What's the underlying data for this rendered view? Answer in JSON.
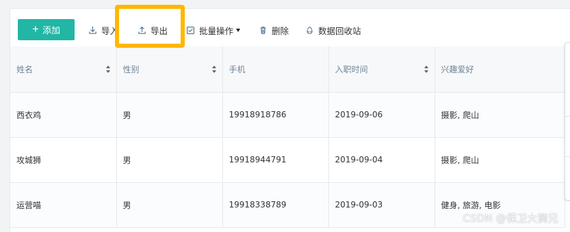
{
  "toolbar": {
    "add_label": "添加",
    "import_label": "导入",
    "export_label": "导出",
    "batch_label": "批量操作",
    "delete_label": "删除",
    "recycle_label": "数据回收站"
  },
  "table": {
    "columns": [
      {
        "label": "姓名",
        "sortable": true
      },
      {
        "label": "性别",
        "sortable": true
      },
      {
        "label": "手机",
        "sortable": false
      },
      {
        "label": "入职时间",
        "sortable": true
      },
      {
        "label": "兴趣爱好",
        "sortable": false
      }
    ],
    "rows": [
      [
        "西衣鸡",
        "男",
        "19918918786",
        "2019-09-06",
        "摄影, 爬山"
      ],
      [
        "攻城狮",
        "男",
        "19918944791",
        "2019-09-04",
        "摄影, 爬山"
      ],
      [
        "运营喵",
        "男",
        "19918338789",
        "2019-09-03",
        "健身, 旅游, 电影"
      ]
    ]
  },
  "icons": {
    "add": "plus-icon",
    "import": "download-icon",
    "export": "upload-icon",
    "batch": "checkbox-icon",
    "batch_dropdown": "caret-down-icon",
    "delete": "trash-icon",
    "recycle": "recycle-icon",
    "sort": "sort-icon"
  },
  "colors": {
    "primary": "#22b6a5",
    "highlight": "#ffb700",
    "header_text": "#6f8596",
    "border": "#e6e8eb"
  },
  "watermark": "CSDN @保卫大狮兄"
}
